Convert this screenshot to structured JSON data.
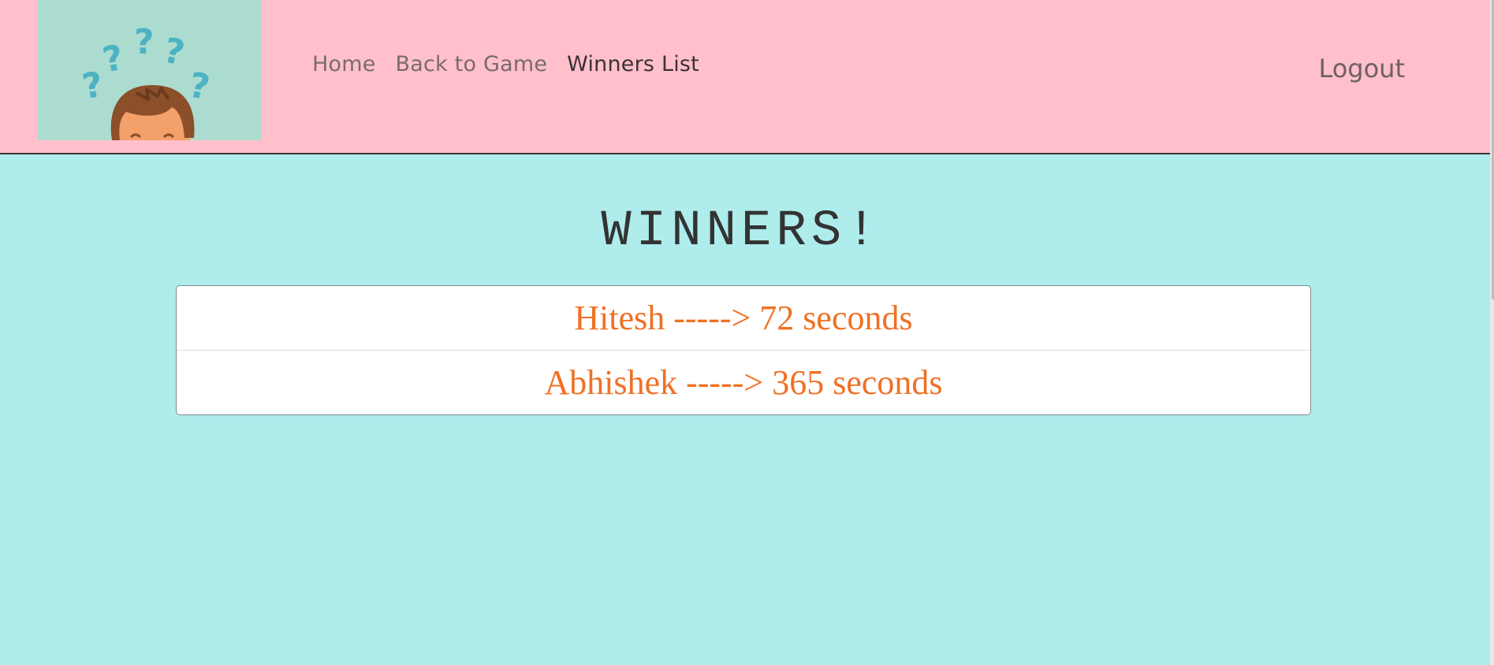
{
  "nav": {
    "links": [
      {
        "label": "Home"
      },
      {
        "label": "Back to Game"
      },
      {
        "label": "Winners List"
      }
    ],
    "logout_label": "Logout",
    "logo_icon": "confused-person-question-marks-icon"
  },
  "main": {
    "title": "WINNERS!",
    "winners": [
      {
        "text": "Hitesh -----> 72 seconds"
      },
      {
        "text": "Abhishek -----> 365 seconds"
      }
    ]
  },
  "colors": {
    "navbar_bg": "#ffc0cb",
    "page_bg": "#afecec",
    "winner_text": "#f07024"
  }
}
